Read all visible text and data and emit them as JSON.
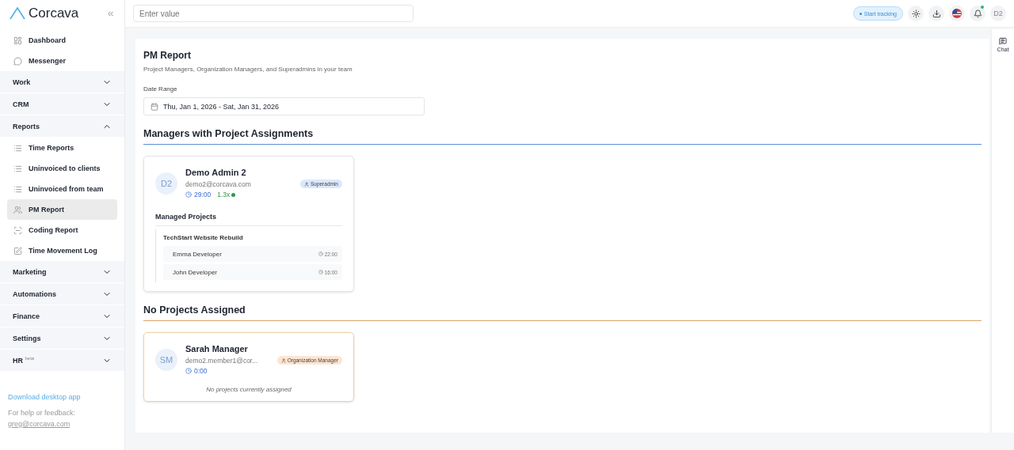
{
  "sidebar": {
    "logo": "Corcava",
    "nav": [
      {
        "kind": "link",
        "label": "Dashboard",
        "selected": false
      },
      {
        "kind": "link",
        "label": "Messenger",
        "selected": false
      },
      {
        "kind": "group",
        "label": "Work",
        "expanded": false
      },
      {
        "kind": "group",
        "label": "CRM",
        "expanded": false
      },
      {
        "kind": "group",
        "label": "Reports",
        "expanded": true,
        "children": [
          {
            "label": "Time Reports",
            "selected": false
          },
          {
            "label": "Uninvoiced to clients",
            "selected": false
          },
          {
            "label": "Uninvoiced from team",
            "selected": false
          },
          {
            "label": "PM Report",
            "selected": true
          },
          {
            "label": "Coding Report",
            "selected": false
          },
          {
            "label": "Time Movement Log",
            "selected": false
          }
        ]
      },
      {
        "kind": "group",
        "label": "Marketing",
        "expanded": false
      },
      {
        "kind": "group",
        "label": "Automations",
        "expanded": false
      },
      {
        "kind": "group",
        "label": "Finance",
        "expanded": false
      },
      {
        "kind": "group",
        "label": "Settings",
        "expanded": false
      },
      {
        "kind": "group",
        "label": "HR",
        "sup": "beta",
        "expanded": false
      }
    ],
    "download": "Download desktop app",
    "help": "For help or feedback:",
    "email": "greg@corcava.com"
  },
  "topbar": {
    "search": {
      "placeholder": "Enter value"
    },
    "tracking": "Start tracking",
    "avatar": "D2"
  },
  "chat": {
    "label": "Chat"
  },
  "report": {
    "title": "PM Report",
    "subtitle": "Project Managers, Organization Managers, and Superadmins in your team",
    "date_label": "Date Range",
    "date_value": "Thu, Jan 1, 2026 - Sat, Jan 31, 2026",
    "sections": [
      {
        "title": "Managers with Project Assignments",
        "color": "#5b8fd6",
        "cards": [
          {
            "initials": "D2",
            "name": "Demo Admin 2",
            "email": "demo2@corcava.com",
            "role": "Superadmin",
            "color": "#dbe8fb",
            "time": "29:00",
            "multiplier": "1.3x",
            "projects_title": "Managed Projects",
            "projects": [
              {
                "name": "TechStart Website Rebuild",
                "members": [
                  {
                    "name": "Emma Developer",
                    "time": "22:00"
                  },
                  {
                    "name": "John Developer",
                    "time": "16:00"
                  }
                ]
              }
            ]
          }
        ]
      },
      {
        "title": "No Projects Assigned",
        "color": "#d9a56a",
        "cards": [
          {
            "initials": "SM",
            "name": "Sarah Manager",
            "email": "demo2.member1@cor...",
            "role": "Organization Manager",
            "color": "#fde5d2",
            "time": "0:00",
            "empty": "No projects currently assigned"
          }
        ]
      }
    ]
  }
}
